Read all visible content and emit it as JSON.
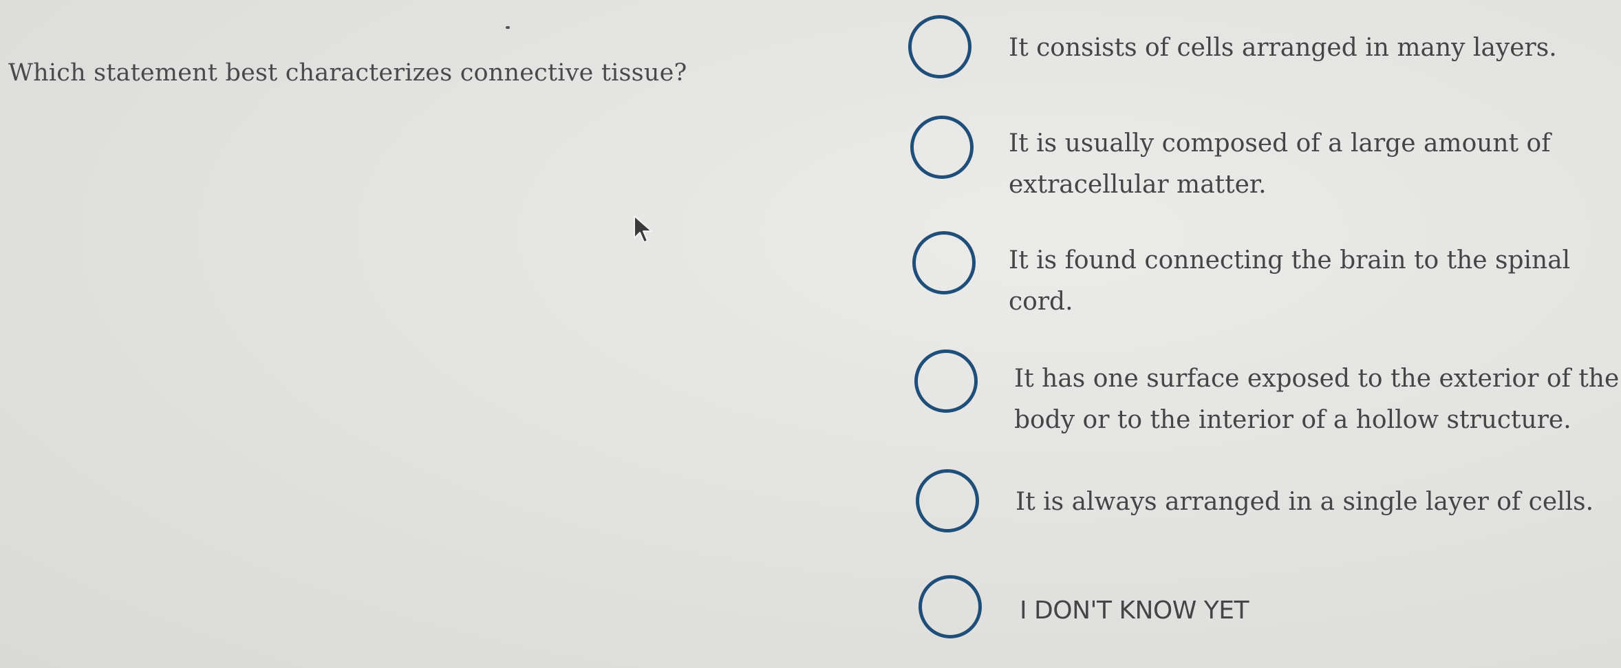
{
  "question": {
    "text": "Which statement best characterizes connective tissue?"
  },
  "options": [
    {
      "line1": "It consists of cells arranged in many layers.",
      "line2": ""
    },
    {
      "line1": "It is usually composed of a large amount of",
      "line2": "extracellular matter."
    },
    {
      "line1": "It is found connecting the brain to the spinal",
      "line2": "cord."
    },
    {
      "line1": "It has one surface exposed to the exterior of the",
      "line2": "body or to the interior of a hollow structure."
    },
    {
      "line1": "It is always arranged in a single layer of cells.",
      "line2": ""
    },
    {
      "line1": "I DON'T KNOW YET",
      "line2": ""
    }
  ],
  "colors": {
    "radio_border": "#1f4e78",
    "text": "#454545"
  },
  "icons": {
    "cursor": "mouse-pointer-icon"
  }
}
